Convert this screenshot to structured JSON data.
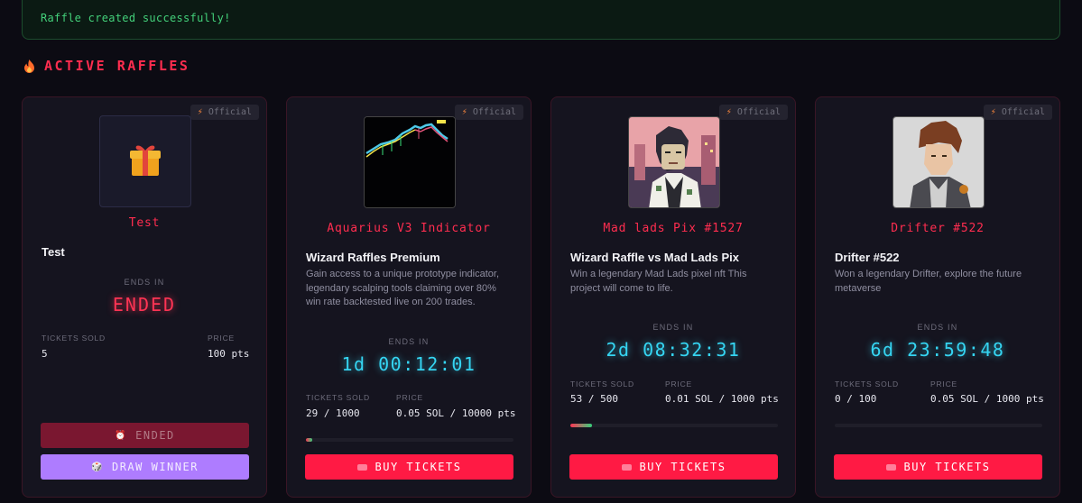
{
  "toast": {
    "message": "Raffle created successfully!"
  },
  "section": {
    "title": "ACTIVE RAFFLES",
    "icon": "flame-icon"
  },
  "colors": {
    "accent": "#ff1a44",
    "countdown": "#35d5f2",
    "success": "#43d07a",
    "draw": "#ae7cff"
  },
  "raffles": [
    {
      "badge": "Official",
      "nft_name": "Test",
      "title": "Test",
      "description": "",
      "ends_label": "ENDS IN",
      "countdown": "ENDED",
      "tickets_label": "TICKETS SOLD",
      "tickets_value": "5",
      "price_label": "PRICE",
      "price_value": "100 pts",
      "buttons": {
        "ended": "ENDED",
        "draw": "DRAW WINNER"
      }
    },
    {
      "badge": "Official",
      "nft_name": "Aquarius V3 Indicator",
      "title": "Wizard Raffles Premium",
      "description": "Gain access to a unique prototype indicator, legendary scalping tools claiming over 80% win rate backtested live on 200 trades.",
      "ends_label": "ENDS IN",
      "countdown": "1d 00:12:01",
      "tickets_label": "TICKETS SOLD",
      "tickets_value": "29 / 1000",
      "price_label": "PRICE",
      "price_value": "0.05 SOL / 10000 pts",
      "progress": 0.029,
      "buy_label": "BUY TICKETS"
    },
    {
      "badge": "Official",
      "nft_name": "Mad lads Pix #1527",
      "title": "Wizard Raffle vs Mad Lads Pix",
      "description": "Win a legendary Mad Lads pixel nft This project will come to life.",
      "ends_label": "ENDS IN",
      "countdown": "2d 08:32:31",
      "tickets_label": "TICKETS SOLD",
      "tickets_value": "53 / 500",
      "price_label": "PRICE",
      "price_value": "0.01 SOL / 1000 pts",
      "progress": 0.106,
      "buy_label": "BUY TICKETS"
    },
    {
      "badge": "Official",
      "nft_name": "Drifter #522",
      "title": "Drifter #522",
      "description": "Won a legendary Drifter, explore the future metaverse",
      "ends_label": "ENDS IN",
      "countdown": "6d 23:59:48",
      "tickets_label": "TICKETS SOLD",
      "tickets_value": "0 / 100",
      "price_label": "PRICE",
      "price_value": "0.05 SOL / 1000 pts",
      "progress": 0,
      "buy_label": "BUY TICKETS"
    }
  ]
}
